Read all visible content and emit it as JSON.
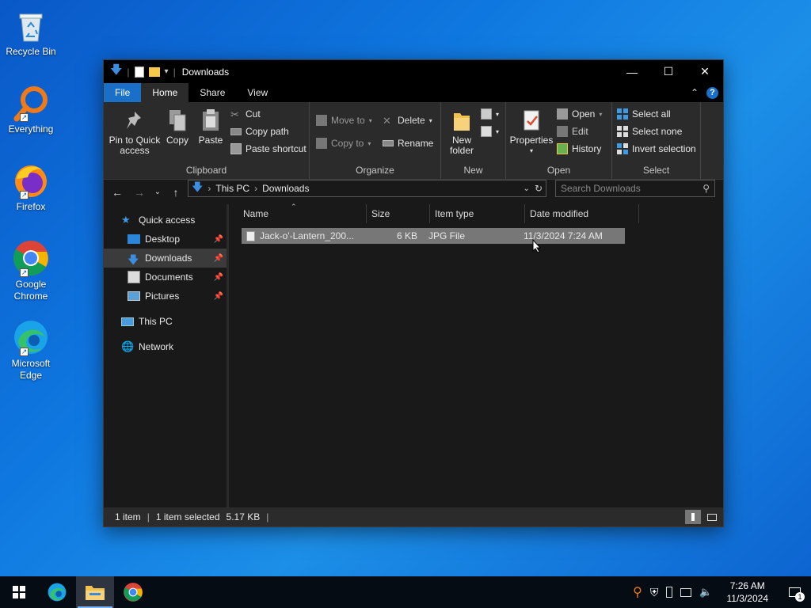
{
  "desktop": {
    "icons": [
      {
        "label": "Recycle Bin",
        "icon": "recycle-bin-icon"
      },
      {
        "label": "Everything",
        "icon": "everything-icon"
      },
      {
        "label": "Firefox",
        "icon": "firefox-icon"
      },
      {
        "label": "Google Chrome",
        "icon": "chrome-icon"
      },
      {
        "label": "Microsoft Edge",
        "icon": "edge-icon"
      }
    ]
  },
  "window": {
    "title": "Downloads",
    "tabs": {
      "file": "File",
      "home": "Home",
      "share": "Share",
      "view": "View"
    },
    "ribbon": {
      "clipboard": {
        "label": "Clipboard",
        "pin": "Pin to Quick access",
        "copy": "Copy",
        "paste": "Paste",
        "cut": "Cut",
        "copy_path": "Copy path",
        "paste_shortcut": "Paste shortcut"
      },
      "organize": {
        "label": "Organize",
        "move_to": "Move to",
        "copy_to": "Copy to",
        "delete": "Delete",
        "rename": "Rename"
      },
      "new": {
        "label": "New",
        "new_folder": "New folder"
      },
      "open": {
        "label": "Open",
        "properties": "Properties",
        "open": "Open",
        "edit": "Edit",
        "history": "History"
      },
      "select": {
        "label": "Select",
        "select_all": "Select all",
        "select_none": "Select none",
        "invert": "Invert selection"
      }
    },
    "address": {
      "crumbs": [
        "This PC",
        "Downloads"
      ]
    },
    "search": {
      "placeholder": "Search Downloads"
    },
    "nav": {
      "quick_access": "Quick access",
      "desktop": "Desktop",
      "downloads": "Downloads",
      "documents": "Documents",
      "pictures": "Pictures",
      "this_pc": "This PC",
      "network": "Network"
    },
    "columns": {
      "name": "Name",
      "size": "Size",
      "type": "Item type",
      "date": "Date modified"
    },
    "files": [
      {
        "name": "Jack-o'-Lantern_200...",
        "size": "6 KB",
        "type": "JPG File",
        "date": "11/3/2024 7:24 AM"
      }
    ],
    "status": {
      "count": "1 item",
      "selected": "1 item selected",
      "size": "5.17 KB"
    }
  },
  "taskbar": {
    "time": "7:26 AM",
    "date": "11/3/2024",
    "notification_count": "1"
  },
  "colors": {
    "accent": "#1a6fc9",
    "window_bg": "#191919",
    "ribbon_bg": "#2b2b2b"
  }
}
